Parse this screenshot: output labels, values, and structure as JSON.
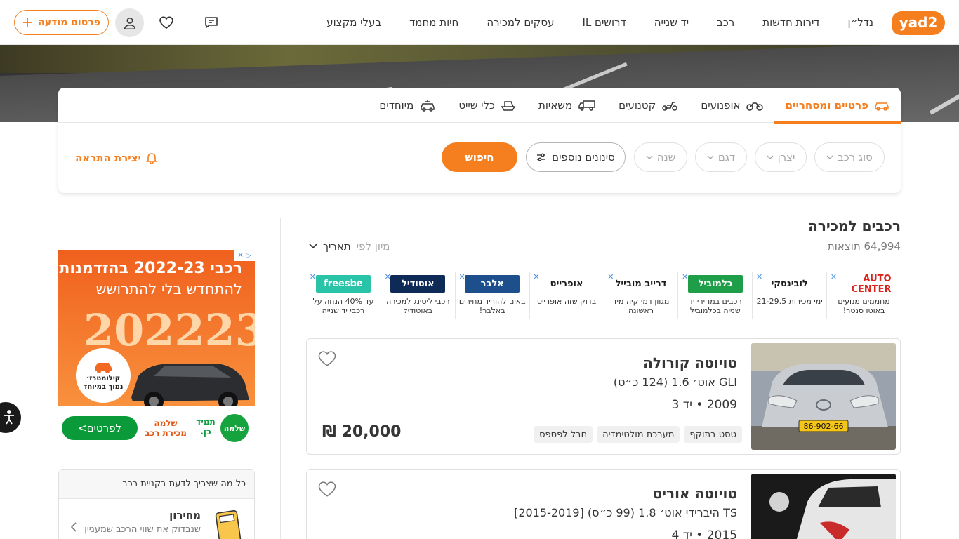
{
  "header": {
    "logo_text": "yad2",
    "nav": [
      "נדל״ן",
      "דירות חדשות",
      "רכב",
      "יד שנייה",
      "דרושים IL",
      "עסקים למכירה",
      "חיות מחמד",
      "בעלי מקצוע"
    ],
    "post_ad_label": "פרסום מודעה",
    "accent_color": "#f57e1e"
  },
  "search": {
    "tabs": [
      "פרטיים ומסחריים",
      "אופנועים",
      "קטנועים",
      "משאיות",
      "כלי שייט",
      "מיוחדים"
    ],
    "active_tab": 0,
    "filters": [
      "סוג רכב",
      "יצרן",
      "דגם",
      "שנה"
    ],
    "more_filters_label": "סינונים נוספים",
    "search_label": "חיפוש",
    "alert_label": "יצירת התראה"
  },
  "results": {
    "title": "רכבים למכירה",
    "count": "64,994 תוצאות",
    "sort_label": "מיון לפי",
    "sort_value": "תאריך"
  },
  "ad_strip": [
    {
      "logo": "AUTO CENTER",
      "text": "מחממים מנועים באוטו סנטר!",
      "color": "#ffffff",
      "fg": "#d9241c"
    },
    {
      "logo": "לובינסקי",
      "text": "ימי מכירות 21-29.5",
      "color": "#ffffff",
      "fg": "#1a1a1a"
    },
    {
      "logo": "כלמוביל",
      "text": "רכבים במחירי יד שנייה בכלמוביל",
      "color": "#1f9e4a",
      "fg": "#ffffff"
    },
    {
      "logo": "דרייב מובייל",
      "text": "מגוון דמי קיה מיד ראשונה",
      "color": "#ffffff",
      "fg": "#1a1a1a"
    },
    {
      "logo": "אופרייט",
      "text": "בדוק שזה אופרייט",
      "color": "#ffffff",
      "fg": "#1a1a1a"
    },
    {
      "logo": "אלבר",
      "text": "באים להוריד מחירים באלבר!",
      "color": "#1d4f8c",
      "fg": "#ffffff"
    },
    {
      "logo": "אוטודיל",
      "text": "רכבי ליסינג למכירה באוטודיל",
      "color": "#0e2b57",
      "fg": "#ffffff"
    },
    {
      "logo": "freesbe",
      "text": "עד 40% הנחה על רכבי יד שנייה",
      "color": "#29c4a8",
      "fg": "#ffffff"
    }
  ],
  "listings": [
    {
      "title": "טויוטה קורולה",
      "subtitle": "GLI אוט׳ 1.6 (124 כ״ס)",
      "meta": "2009 • יד 3",
      "tags": [
        "טסט בתוקף",
        "מערכת מולטימדיה",
        "חבל לפספס"
      ],
      "price": "20,000 ₪",
      "plate": "86-902-66"
    },
    {
      "title": "טויוטה אוריס",
      "subtitle": "TS היברידי אוט׳ 1.8 (99 כ״ס) [2015-2019]",
      "meta": "2015 • יד 4",
      "tags": [],
      "price": "",
      "plate": ""
    }
  ],
  "side_ad": {
    "headline": "רכבי 2022-23 בהזדמנות",
    "subline": "להתחדש בלי להתרושש",
    "big_year": "202223",
    "badge": "קילומטרז׳ נמוך במיוחד",
    "cta": "לפרטים>",
    "brand": "שלמה מכירת רכב",
    "brand2": "תמיד כן.",
    "logo": "שלמה"
  },
  "guide": {
    "header": "כל מה שצריך לדעת בקניית רכב",
    "item_title": "מחירון",
    "item_desc": "שנבדוק את שווי הרכב שמעניין"
  }
}
